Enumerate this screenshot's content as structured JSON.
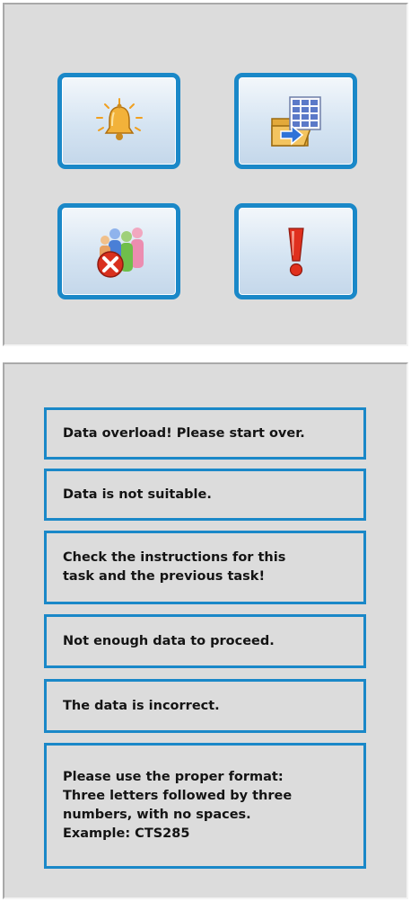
{
  "icon_panel": {
    "buttons": [
      {
        "icon": "bell-alarm-icon"
      },
      {
        "icon": "import-data-icon"
      },
      {
        "icon": "delete-group-icon"
      },
      {
        "icon": "exclamation-icon"
      }
    ]
  },
  "colors": {
    "accent_border": "#1a88c8",
    "panel_background": "#dcdcdc",
    "text": "#141414"
  },
  "messages": [
    "Data overload!  Please start over.",
    "Data is not suitable.",
    "Check the instructions for this\ntask and the previous task!",
    "Not enough data to proceed.",
    "The data is incorrect.",
    "Please use  the proper format:\nThree letters followed by three\nnumbers, with no spaces.\nExample:  CTS285"
  ]
}
